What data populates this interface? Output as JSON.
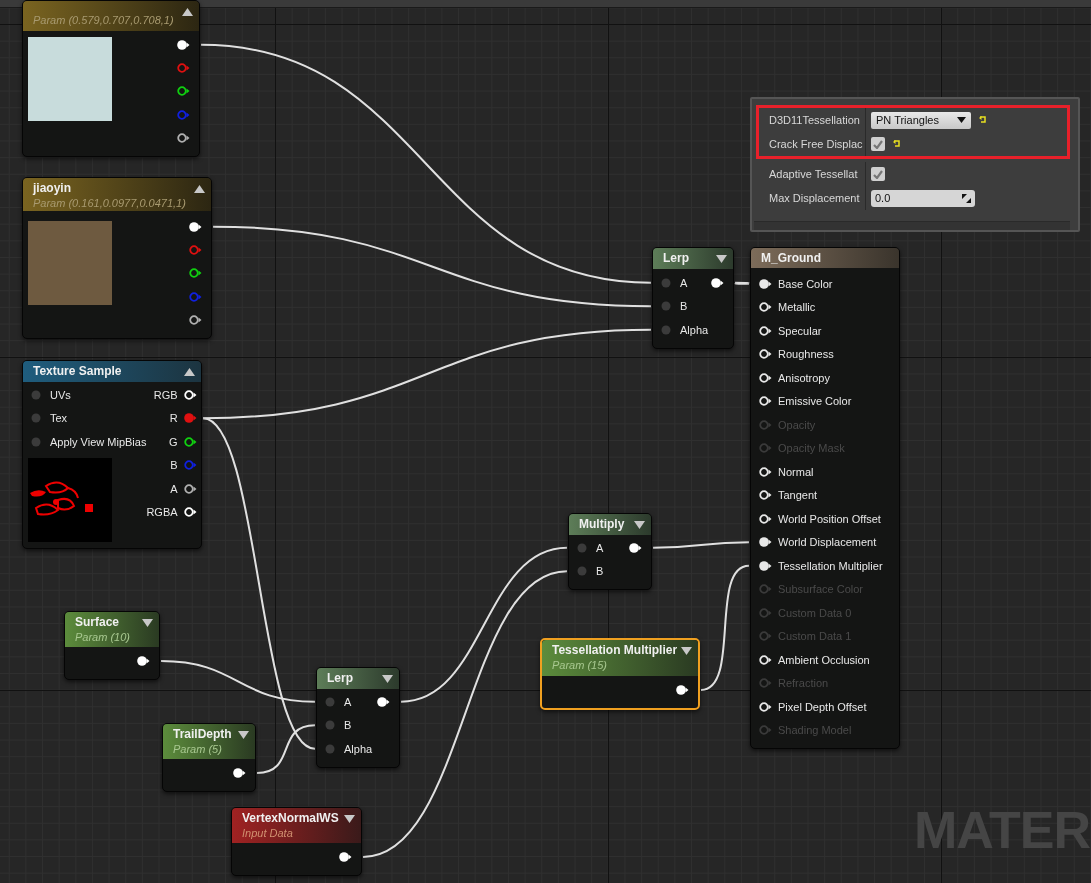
{
  "nodes": [
    {
      "kind": "vector_param",
      "subtitle": "Param (0.579,0.707,0.708,1)",
      "expanded": true,
      "preview": {
        "kind": "swatch",
        "color": "#c8dcdc"
      },
      "outputs": [
        {
          "color": "#ffffff",
          "connected": true
        },
        {
          "color": "#e01010",
          "connected": false
        },
        {
          "color": "#10d010",
          "connected": false
        },
        {
          "color": "#1020e0",
          "connected": false
        },
        {
          "color": "#b0b0b0",
          "connected": false
        }
      ]
    },
    {
      "kind": "vector_param",
      "title": "jiaoyin",
      "subtitle": "Param (0.161,0.0977,0.0471,1)",
      "expanded": true,
      "preview": {
        "kind": "swatch",
        "color": "#6e5a40"
      },
      "outputs": [
        {
          "color": "#ffffff",
          "connected": true
        },
        {
          "color": "#e01010",
          "connected": false
        },
        {
          "color": "#10d010",
          "connected": false
        },
        {
          "color": "#1020e0",
          "connected": false
        },
        {
          "color": "#b0b0b0",
          "connected": false
        }
      ]
    },
    {
      "kind": "texture",
      "title": "Texture Sample",
      "expanded": true,
      "preview": {
        "kind": "picture"
      },
      "inputs": [
        {
          "label": "UVs"
        },
        {
          "label": "Tex"
        },
        {
          "label": "Apply View MipBias"
        }
      ],
      "outputs": [
        {
          "label": "RGB",
          "color": "#ffffff",
          "connected": false
        },
        {
          "label": "R",
          "color": "#e01010",
          "connected": true
        },
        {
          "label": "G",
          "color": "#10d010",
          "connected": false
        },
        {
          "label": "B",
          "color": "#1020e0",
          "connected": false
        },
        {
          "label": "A",
          "color": "#b0b0b0",
          "connected": false
        },
        {
          "label": "RGBA",
          "color": "#ffffff",
          "connected": false
        }
      ]
    },
    {
      "kind": "math",
      "title": "Lerp",
      "expanded": false,
      "inputs": [
        {
          "label": "A"
        },
        {
          "label": "B"
        },
        {
          "label": "Alpha"
        }
      ],
      "outputs": [
        {
          "color": "#ffffff",
          "connected": true
        }
      ]
    },
    {
      "kind": "material",
      "title": "M_Ground",
      "inputs": [
        {
          "label": "Base Color",
          "connected": true,
          "disabled": false
        },
        {
          "label": "Metallic",
          "connected": false,
          "disabled": false
        },
        {
          "label": "Specular",
          "connected": false,
          "disabled": false
        },
        {
          "label": "Roughness",
          "connected": false,
          "disabled": false
        },
        {
          "label": "Anisotropy",
          "connected": false,
          "disabled": false
        },
        {
          "label": "Emissive Color",
          "connected": false,
          "disabled": false
        },
        {
          "label": "Opacity",
          "connected": false,
          "disabled": true
        },
        {
          "label": "Opacity Mask",
          "connected": false,
          "disabled": true
        },
        {
          "label": "Normal",
          "connected": false,
          "disabled": false
        },
        {
          "label": "Tangent",
          "connected": false,
          "disabled": false
        },
        {
          "label": "World Position Offset",
          "connected": false,
          "disabled": false
        },
        {
          "label": "World Displacement",
          "connected": true,
          "disabled": false
        },
        {
          "label": "Tessellation Multiplier",
          "connected": true,
          "disabled": false
        },
        {
          "label": "Subsurface Color",
          "connected": false,
          "disabled": true
        },
        {
          "label": "Custom Data 0",
          "connected": false,
          "disabled": true
        },
        {
          "label": "Custom Data 1",
          "connected": false,
          "disabled": true
        },
        {
          "label": "Ambient Occlusion",
          "connected": false,
          "disabled": false
        },
        {
          "label": "Refraction",
          "connected": false,
          "disabled": true
        },
        {
          "label": "Pixel Depth Offset",
          "connected": false,
          "disabled": false
        },
        {
          "label": "Shading Model",
          "connected": false,
          "disabled": true
        }
      ]
    },
    {
      "kind": "math",
      "title": "Multiply",
      "expanded": false,
      "inputs": [
        {
          "label": "A"
        },
        {
          "label": "B"
        }
      ],
      "outputs": [
        {
          "color": "#ffffff",
          "connected": true
        }
      ]
    },
    {
      "kind": "scalar_param",
      "title": "Surface",
      "subtitle": "Param (10)",
      "expanded": false,
      "outputs": [
        {
          "color": "#ffffff",
          "connected": true
        }
      ]
    },
    {
      "kind": "scalar_param",
      "title": "TrailDepth",
      "subtitle": "Param (5)",
      "expanded": false,
      "outputs": [
        {
          "color": "#ffffff",
          "connected": true
        }
      ]
    },
    {
      "kind": "math",
      "title": "Lerp",
      "expanded": false,
      "inputs": [
        {
          "label": "A"
        },
        {
          "label": "B"
        },
        {
          "label": "Alpha"
        }
      ],
      "outputs": [
        {
          "color": "#ffffff",
          "connected": true
        }
      ]
    },
    {
      "kind": "input_data",
      "title": "VertexNormalWS",
      "subtitle": "Input Data",
      "expanded": false,
      "outputs": [
        {
          "color": "#ffffff",
          "connected": true
        }
      ]
    },
    {
      "kind": "scalar_param",
      "title": "Tessellation Multiplier",
      "subtitle": "Param (15)",
      "expanded": false,
      "selected": true,
      "outputs": [
        {
          "color": "#ffffff",
          "connected": true
        }
      ]
    }
  ],
  "details": {
    "rows": [
      {
        "kind": "dropdown",
        "label": "D3D11Tessellation",
        "value": "PN Triangles",
        "reset": true,
        "highlighted": true
      },
      {
        "kind": "checkbox",
        "label": "Crack Free Displac",
        "checked": true,
        "reset": true,
        "highlighted": true
      },
      {
        "kind": "checkbox",
        "label": "Adaptive Tessellat",
        "checked": true,
        "reset": false,
        "highlighted": false
      },
      {
        "kind": "number",
        "label": "Max Displacement",
        "value": "0.0",
        "reset": false,
        "highlighted": false
      }
    ]
  },
  "canvas_label": "MATER"
}
